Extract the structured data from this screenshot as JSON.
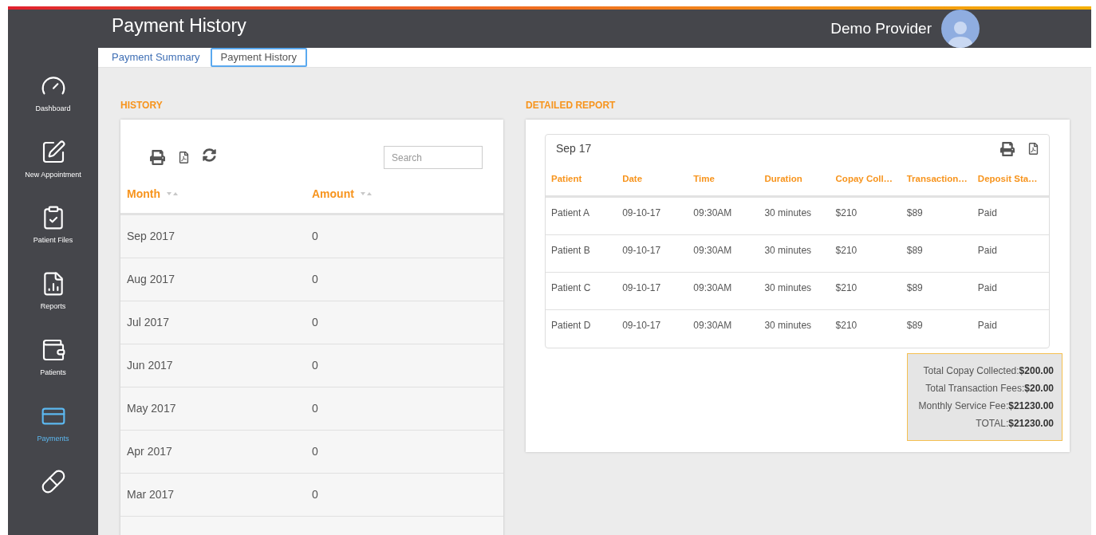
{
  "header": {
    "title": "Payment History",
    "user_name": "Demo Provider"
  },
  "sidebar": {
    "items": [
      {
        "label": "Dashboard",
        "selected": false
      },
      {
        "label": "New Appointment",
        "selected": false
      },
      {
        "label": "Patient Files",
        "selected": false
      },
      {
        "label": "Reports",
        "selected": false
      },
      {
        "label": "Patients",
        "selected": false
      },
      {
        "label": "Payments",
        "selected": true
      },
      {
        "selected": false
      }
    ]
  },
  "tabs": [
    {
      "label": "Payment Summary",
      "selected": false
    },
    {
      "label": "Payment History",
      "selected": true
    }
  ],
  "history": {
    "title": "HISTORY",
    "search": {
      "placeholder": "Search"
    },
    "columns": [
      "Month",
      "Amount"
    ],
    "rows": [
      [
        "Sep 2017",
        "0"
      ],
      [
        "Aug 2017",
        "0"
      ],
      [
        "Jul 2017",
        "0"
      ],
      [
        "Jun 2017",
        "0"
      ],
      [
        "May 2017",
        "0"
      ],
      [
        "Apr 2017",
        "0"
      ],
      [
        "Mar 2017",
        "0"
      ]
    ]
  },
  "report": {
    "title": "DETAILED REPORT",
    "period": "Sep 17",
    "columns": [
      "Patient",
      "Date",
      "Time",
      "Duration",
      "Copay Coll…",
      "Transaction…",
      "Deposit Sta…"
    ],
    "rows": [
      [
        "Patient A",
        "09-10-17",
        "09:30AM",
        "30 minutes",
        "$210",
        "$89",
        "Paid"
      ],
      [
        "Patient B",
        "09-10-17",
        "09:30AM",
        "30 minutes",
        "$210",
        "$89",
        "Paid"
      ],
      [
        "Patient C",
        "09-10-17",
        "09:30AM",
        "30 minutes",
        "$210",
        "$89",
        "Paid"
      ],
      [
        "Patient D",
        "09-10-17",
        "09:30AM",
        "30 minutes",
        "$210",
        "$89",
        "Paid"
      ]
    ],
    "summary": [
      "Total Copay Collected:**$200.00**",
      "Total Transaction Fees:**$20.00**",
      "Monthly Service Fee:**$21230.00**",
      "TOTAL:**$21230.00**"
    ]
  }
}
